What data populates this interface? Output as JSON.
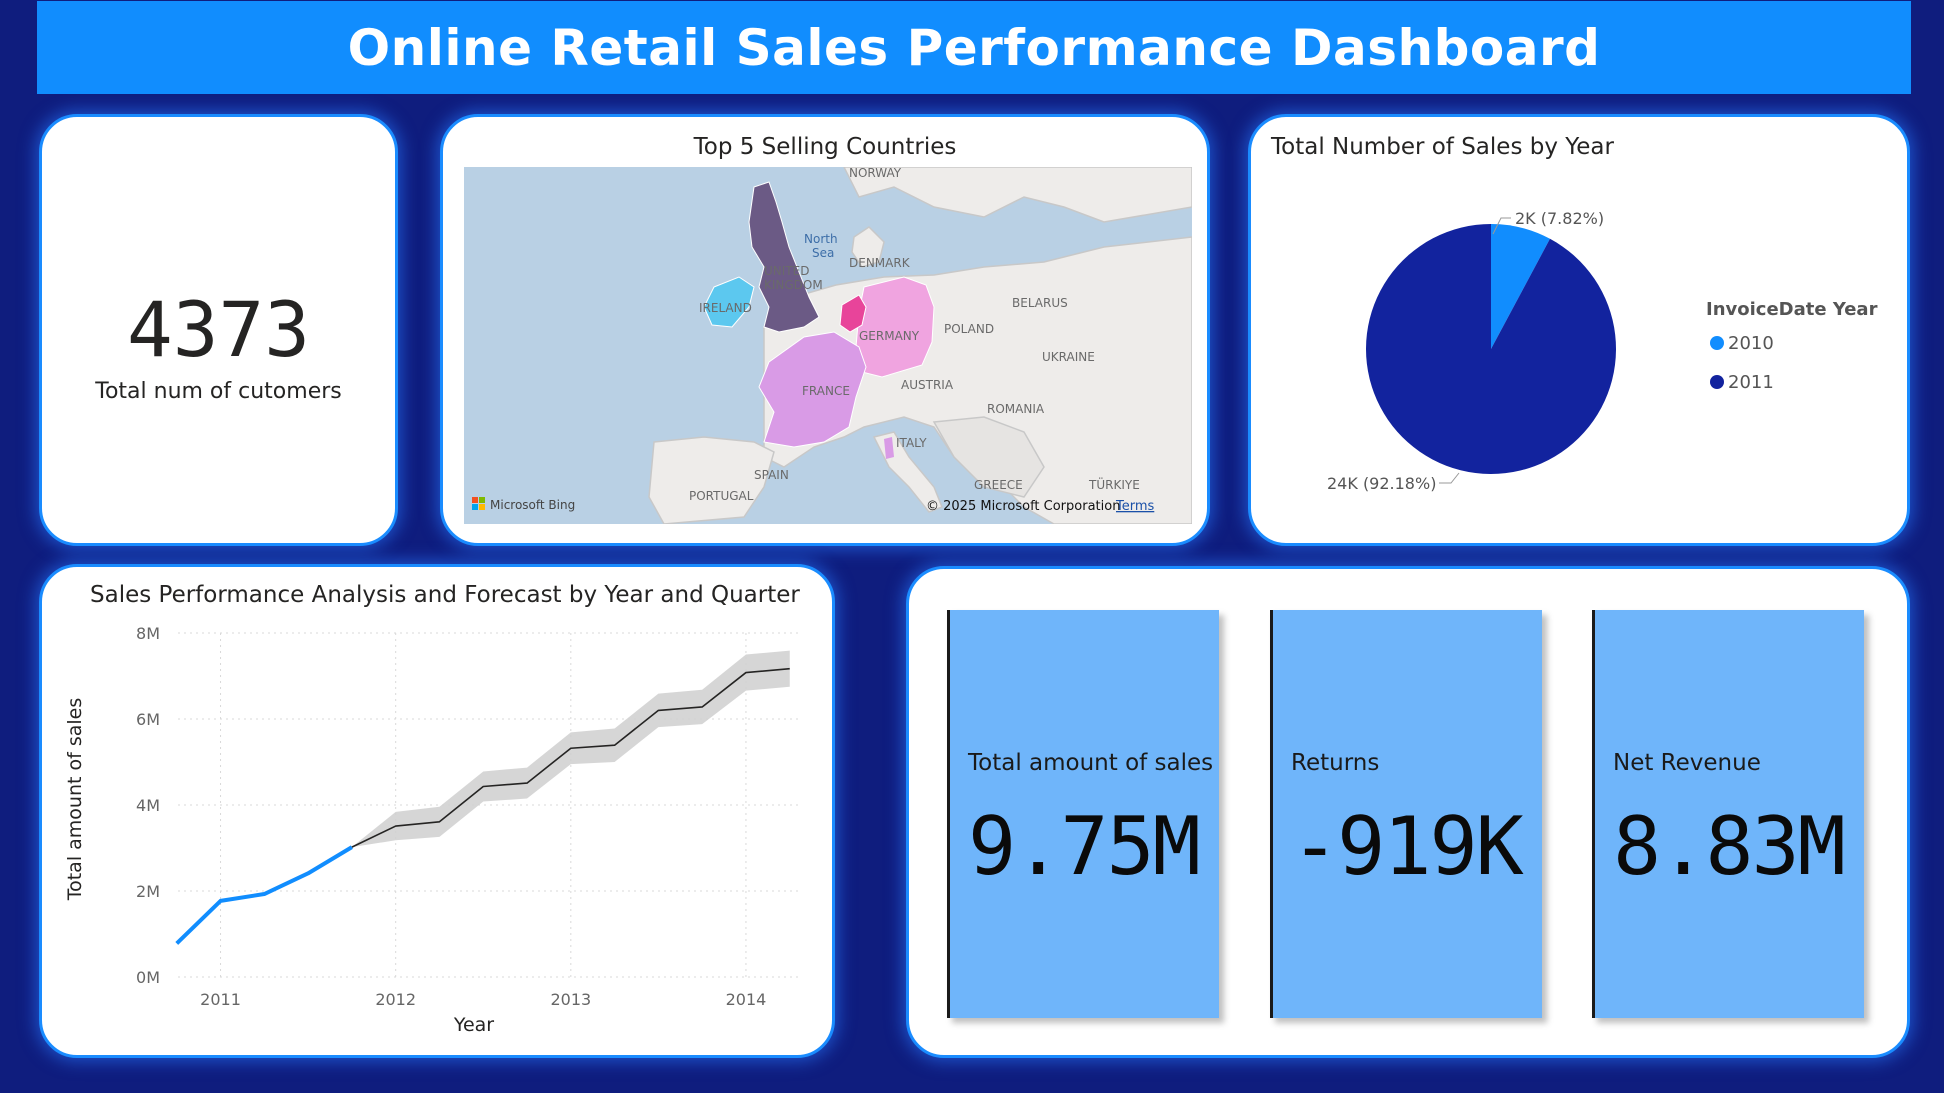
{
  "dashboard": {
    "title": "Online Retail Sales Performance Dashboard"
  },
  "customers": {
    "value": "4373",
    "label": "Total num of cutomers"
  },
  "map": {
    "title": "Top 5 Selling Countries",
    "attribution": "© 2025 Microsoft Corporation",
    "terms": "Terms",
    "brand": "Microsoft Bing",
    "labels": [
      "NORWAY",
      "North",
      "Sea",
      "DENMARK",
      "UNITED",
      "KINGDOM",
      "IRELAND",
      "GERMANY",
      "BELARUS",
      "POLAND",
      "UKRAINE",
      "FRANCE",
      "AUSTRIA",
      "ROMANIA",
      "ITALY",
      "SPAIN",
      "PORTUGAL",
      "GREECE",
      "TÜRKIYE"
    ],
    "highlight_colors": {
      "United Kingdom": "#6b5a85",
      "Ireland": "#5cc8ef",
      "Netherlands": "#e8449a",
      "Germany": "#f0a4e0",
      "France": "#d99be6"
    }
  },
  "pie": {
    "title": "Total Number of Sales by Year",
    "legend_title": "InvoiceDate Year",
    "colors": {
      "2010": "#118dfe",
      "2011": "#12239e"
    },
    "label_2010": "2K (7.82%)",
    "label_2011": "24K (92.18%)"
  },
  "kpis": [
    {
      "label": "Total amount of sales",
      "value": "9.75M"
    },
    {
      "label": "Returns",
      "value": "-919K"
    },
    {
      "label": "Net Revenue",
      "value": "8.83M"
    }
  ],
  "chart_data": [
    {
      "type": "pie",
      "title": "Total Number of Sales by Year",
      "legend_title": "InvoiceDate Year",
      "categories": [
        "2010",
        "2011"
      ],
      "values": [
        7.82,
        92.18
      ],
      "data_labels": [
        "2K (7.82%)",
        "24K (92.18%)"
      ],
      "legend_position": "right"
    },
    {
      "type": "line",
      "title": "Sales Performance Analysis and Forecast by Year and Quarter",
      "xlabel": "Year",
      "ylabel": "Total amount of sales",
      "x_ticks": [
        "2011",
        "2012",
        "2013",
        "2014"
      ],
      "y_ticks": [
        "0M",
        "2M",
        "4M",
        "6M",
        "8M"
      ],
      "ylim": [
        0,
        8
      ],
      "grid": true,
      "series": [
        {
          "role": "actual",
          "color": "#118dfe",
          "x": [
            2010.75,
            2011.0,
            2011.25,
            2011.5,
            2011.75
          ],
          "y": [
            0.78,
            1.77,
            1.93,
            2.41,
            3.02
          ]
        },
        {
          "role": "forecast",
          "color": "#252423",
          "x": [
            2011.75,
            2012.0,
            2012.25,
            2012.5,
            2012.75,
            2013.0,
            2013.25,
            2013.5,
            2013.75,
            2014.0,
            2014.25
          ],
          "y": [
            3.02,
            3.51,
            3.61,
            4.43,
            4.51,
            5.32,
            5.39,
            6.2,
            6.28,
            7.08,
            7.17
          ],
          "upper": [
            3.02,
            3.84,
            3.96,
            4.78,
            4.87,
            5.69,
            5.78,
            6.59,
            6.68,
            7.5,
            7.59
          ],
          "lower": [
            3.02,
            3.18,
            3.26,
            4.08,
            4.15,
            4.95,
            5.0,
            5.81,
            5.88,
            6.66,
            6.75
          ]
        }
      ]
    }
  ]
}
